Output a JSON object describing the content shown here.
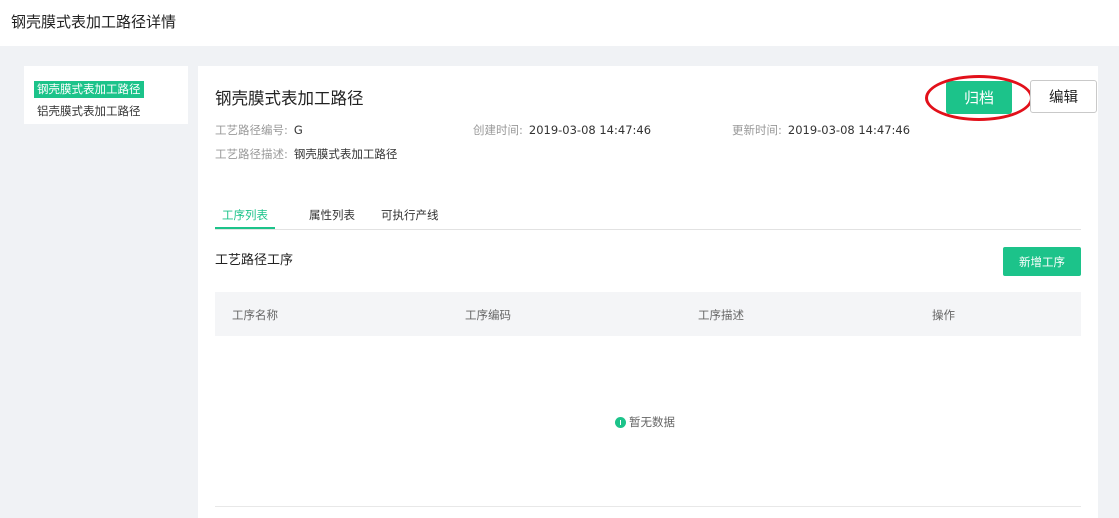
{
  "header": {
    "title": "钢壳膜式表加工路径详情"
  },
  "sidebar": {
    "items": [
      {
        "label": "钢壳膜式表加工路径",
        "active": true
      },
      {
        "label": "铝壳膜式表加工路径",
        "active": false
      }
    ]
  },
  "detail": {
    "title": "钢壳膜式表加工路径",
    "archive_label": "归档",
    "edit_label": "编辑",
    "fields": {
      "code_label": "工艺路径编号:",
      "code_value": "G",
      "created_label": "创建时间:",
      "created_value": "2019-03-08 14:47:46",
      "updated_label": "更新时间:",
      "updated_value": "2019-03-08 14:47:46",
      "desc_label": "工艺路径描述:",
      "desc_value": "钢壳膜式表加工路径"
    }
  },
  "tabs": [
    {
      "label": "工序列表",
      "active": true
    },
    {
      "label": "属性列表",
      "active": false
    },
    {
      "label": "可执行产线",
      "active": false
    }
  ],
  "section": {
    "title": "工艺路径工序",
    "add_label": "新增工序"
  },
  "table": {
    "columns": [
      "工序名称",
      "工序编码",
      "工序描述",
      "操作"
    ],
    "rows": [],
    "empty_text": "暂无数据"
  },
  "colors": {
    "accent": "#1cc38a",
    "highlight_ring": "#e2101a",
    "background": "#f0f2f5"
  }
}
